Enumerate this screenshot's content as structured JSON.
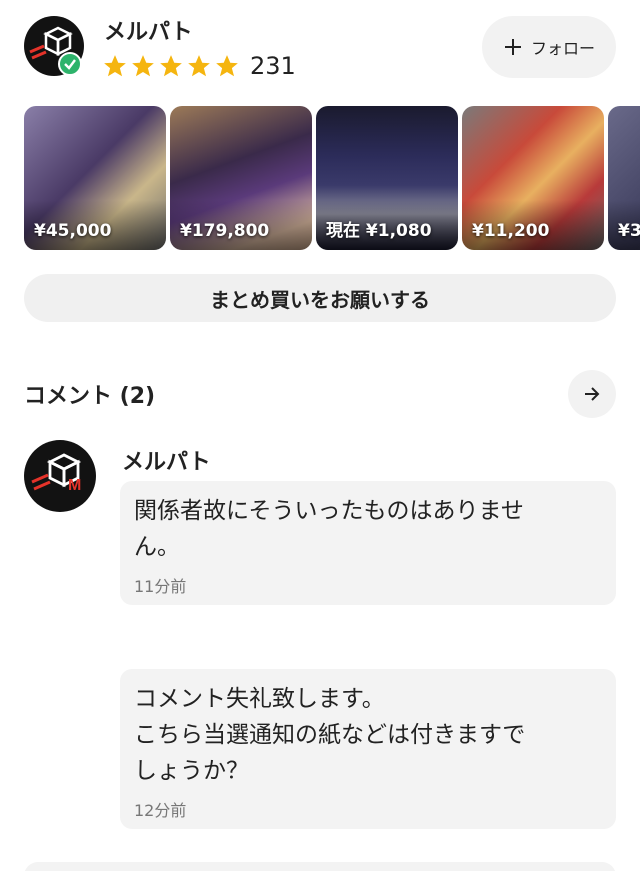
{
  "seller": {
    "name": "メルパト",
    "rating_stars": 5,
    "rating_count": "231",
    "verified": true,
    "follow_label": "フォロー"
  },
  "listings": [
    {
      "price": "¥45,000"
    },
    {
      "price": "¥179,800"
    },
    {
      "price": "現在 ¥1,080"
    },
    {
      "price": "¥11,200"
    },
    {
      "price": "¥3"
    }
  ],
  "bulk_button_label": "まとめ買いをお願いする",
  "comments": {
    "title": "コメント (2)",
    "items": [
      {
        "author": "メルパト",
        "text": "関係者故にそういったものはありませ\nん。",
        "time": "11分前"
      },
      {
        "author": "",
        "text": "コメント失礼致します。\nこちら当選通知の紙などは付きますで\nしょうか？",
        "time": "12分前"
      }
    ]
  },
  "colors": {
    "star": "#f5b50f",
    "verified": "#2db36b",
    "logo_red": "#e5332a"
  },
  "icons": {
    "follow": "plus-icon",
    "comments_more": "arrow-right-icon",
    "verified": "check-shield-icon"
  }
}
